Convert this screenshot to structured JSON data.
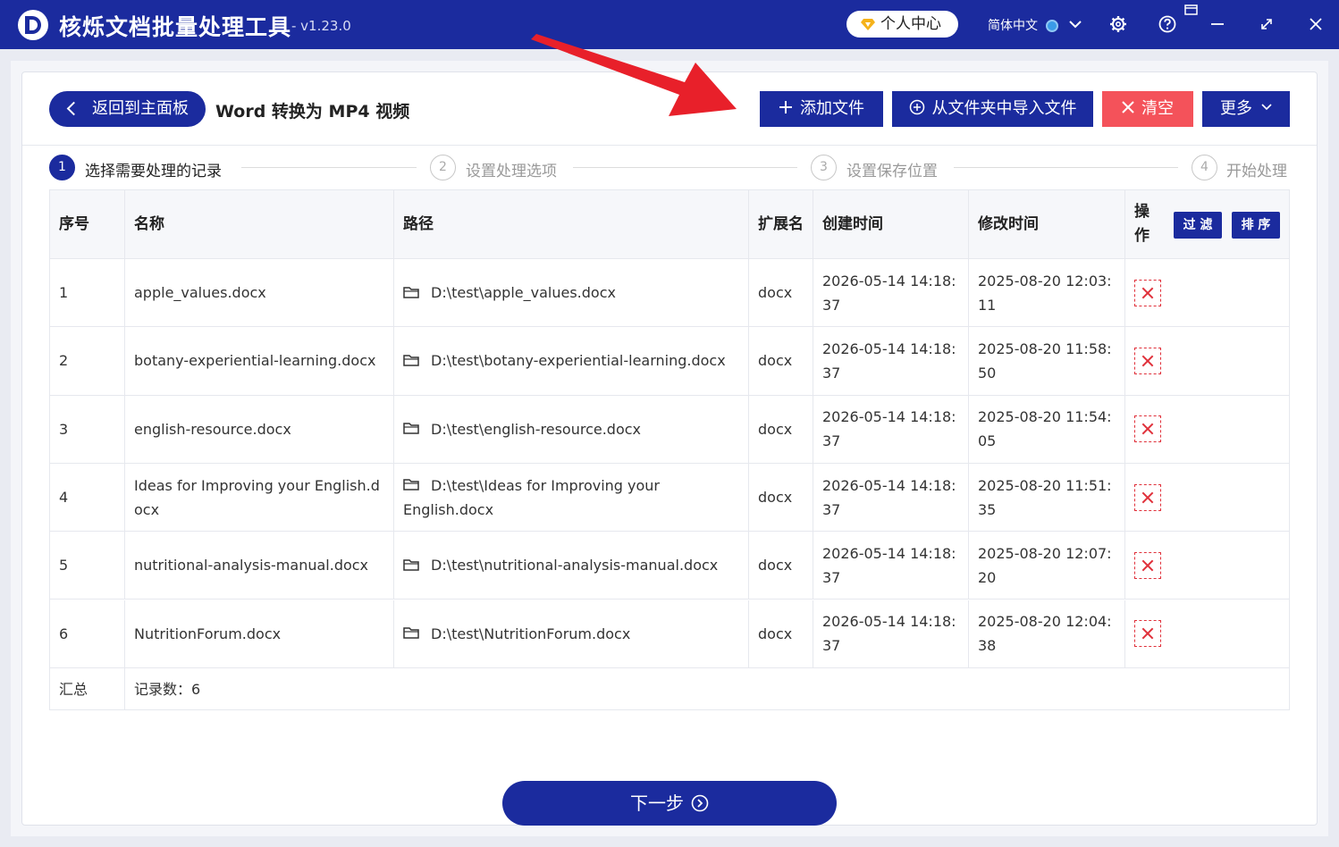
{
  "app": {
    "title": "核烁文档批量处理工具",
    "version": "- v1.23.0"
  },
  "titlebar": {
    "user_center": "个人中心",
    "language": "简体中文"
  },
  "header": {
    "back_label": "返回到主面板",
    "page_title": "Word 转换为 MP4 视频",
    "add_file": "添加文件",
    "import_folder": "从文件夹中导入文件",
    "clear": "清空",
    "more": "更多"
  },
  "steps": [
    {
      "num": "1",
      "label": "选择需要处理的记录"
    },
    {
      "num": "2",
      "label": "设置处理选项"
    },
    {
      "num": "3",
      "label": "设置保存位置"
    },
    {
      "num": "4",
      "label": "开始处理"
    }
  ],
  "table": {
    "headers": {
      "index": "序号",
      "name": "名称",
      "path": "路径",
      "ext": "扩展名",
      "created": "创建时间",
      "modified": "修改时间",
      "action": "操作"
    },
    "filter_label": "过 滤",
    "sort_label": "排 序",
    "rows": [
      {
        "index": "1",
        "name": "apple_values.docx",
        "path": "D:\\test\\apple_values.docx",
        "ext": "docx",
        "created": "2026-05-14 14:18:37",
        "modified": "2025-08-20 12:03:11"
      },
      {
        "index": "2",
        "name": "botany-experiential-learning.docx",
        "path": "D:\\test\\botany-experiential-learning.docx",
        "ext": "docx",
        "created": "2026-05-14 14:18:37",
        "modified": "2025-08-20 11:58:50"
      },
      {
        "index": "3",
        "name": "english-resource.docx",
        "path": "D:\\test\\english-resource.docx",
        "ext": "docx",
        "created": "2026-05-14 14:18:37",
        "modified": "2025-08-20 11:54:05"
      },
      {
        "index": "4",
        "name": "Ideas for Improving your English.docx",
        "path": "D:\\test\\Ideas for Improving your English.docx",
        "ext": "docx",
        "created": "2026-05-14 14:18:37",
        "modified": "2025-08-20 11:51:35"
      },
      {
        "index": "5",
        "name": "nutritional-analysis-manual.docx",
        "path": "D:\\test\\nutritional-analysis-manual.docx",
        "ext": "docx",
        "created": "2026-05-14 14:18:37",
        "modified": "2025-08-20 12:07:20"
      },
      {
        "index": "6",
        "name": "NutritionForum.docx",
        "path": "D:\\test\\NutritionForum.docx",
        "ext": "docx",
        "created": "2026-05-14 14:18:37",
        "modified": "2025-08-20 12:04:38"
      }
    ],
    "summary_label": "汇总",
    "summary_value": "记录数：6"
  },
  "footer": {
    "next_label": "下一步"
  },
  "colors": {
    "primary": "#1b2b9e",
    "danger": "#f4525a",
    "arrow": "#e8202a"
  }
}
